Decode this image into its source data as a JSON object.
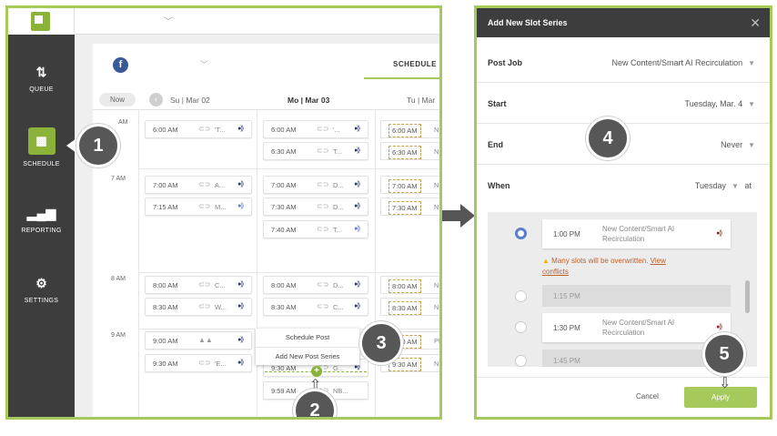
{
  "sidebar": {
    "items": [
      {
        "label": "QUEUE",
        "icon": "sort-arrows-icon"
      },
      {
        "label": "SCHEDULE",
        "icon": "calendar-icon"
      },
      {
        "label": "REPORTING",
        "icon": "bar-chart-icon"
      },
      {
        "label": "SETTINGS",
        "icon": "gear-icon"
      }
    ]
  },
  "header": {
    "tab": "SCHEDULE",
    "now_label": "Now",
    "days": [
      "Su | Mar 02",
      "Mo | Mar 03",
      "Tu | Mar"
    ]
  },
  "hours": [
    "AM",
    "7 AM",
    "8 AM",
    "9 AM"
  ],
  "slots": {
    "sun": [
      {
        "time": "6:00 AM",
        "text": "'T..."
      },
      {
        "time": "7:00 AM",
        "text": "A..."
      },
      {
        "time": "7:15 AM",
        "text": "M..."
      },
      {
        "time": "8:00 AM",
        "text": "C..."
      },
      {
        "time": "8:30 AM",
        "text": "W..."
      },
      {
        "time": "9:00 AM",
        "text": ""
      },
      {
        "time": "9:30 AM",
        "text": "'E..."
      }
    ],
    "mon": [
      {
        "time": "6:00 AM",
        "text": "'..."
      },
      {
        "time": "6:30 AM",
        "text": "T..."
      },
      {
        "time": "7:00 AM",
        "text": "D..."
      },
      {
        "time": "7:30 AM",
        "text": "D..."
      },
      {
        "time": "7:40 AM",
        "text": "T..."
      },
      {
        "time": "8:00 AM",
        "text": "D..."
      },
      {
        "time": "8:30 AM",
        "text": "C..."
      },
      {
        "time": "9:30 AM",
        "text": "G..."
      },
      {
        "time": "9:59 AM",
        "text": "NB..."
      }
    ],
    "tue": [
      {
        "time": "6:00 AM",
        "text": "N"
      },
      {
        "time": "6:30 AM",
        "text": "N"
      },
      {
        "time": "7:00 AM",
        "text": "N"
      },
      {
        "time": "7:30 AM",
        "text": "N"
      },
      {
        "time": "8:00 AM",
        "text": "N"
      },
      {
        "time": "8:30 AM",
        "text": "N"
      },
      {
        "time": "9:00 AM",
        "text": "Ph"
      },
      {
        "time": "9:30 AM",
        "text": "N"
      }
    ]
  },
  "context_menu": {
    "schedule_post": "Schedule Post",
    "add_series": "Add New Post Series"
  },
  "badges": [
    "1",
    "2",
    "3",
    "4",
    "5"
  ],
  "modal": {
    "title": "Add New Slot Series",
    "fields": [
      {
        "label": "Post Job",
        "value": "New Content/Smart AI Recirculation"
      },
      {
        "label": "Start",
        "value": "Tuesday, Mar. 4"
      },
      {
        "label": "End",
        "value": "Never"
      },
      {
        "label": "When",
        "value": "Tuesday",
        "suffix": "at"
      }
    ],
    "times": [
      {
        "time": "1:00 PM",
        "name": "New Content/Smart AI Recirculation",
        "selected": true
      },
      {
        "time": "1:15 PM",
        "name": "",
        "selected": false
      },
      {
        "time": "1:30 PM",
        "name": "New Content/Smart AI Recirculation",
        "selected": false
      },
      {
        "time": "1:45 PM",
        "name": "",
        "selected": false
      }
    ],
    "warning": "Many slots will be overwritten.",
    "warning_link_1": "View",
    "warning_link_2": "conflicts",
    "cancel": "Cancel",
    "apply": "Apply"
  },
  "colors": {
    "accent": "#a6c95b",
    "sidebar": "#3d3d3d",
    "badge": "#575757",
    "warning": "#c0602b"
  }
}
